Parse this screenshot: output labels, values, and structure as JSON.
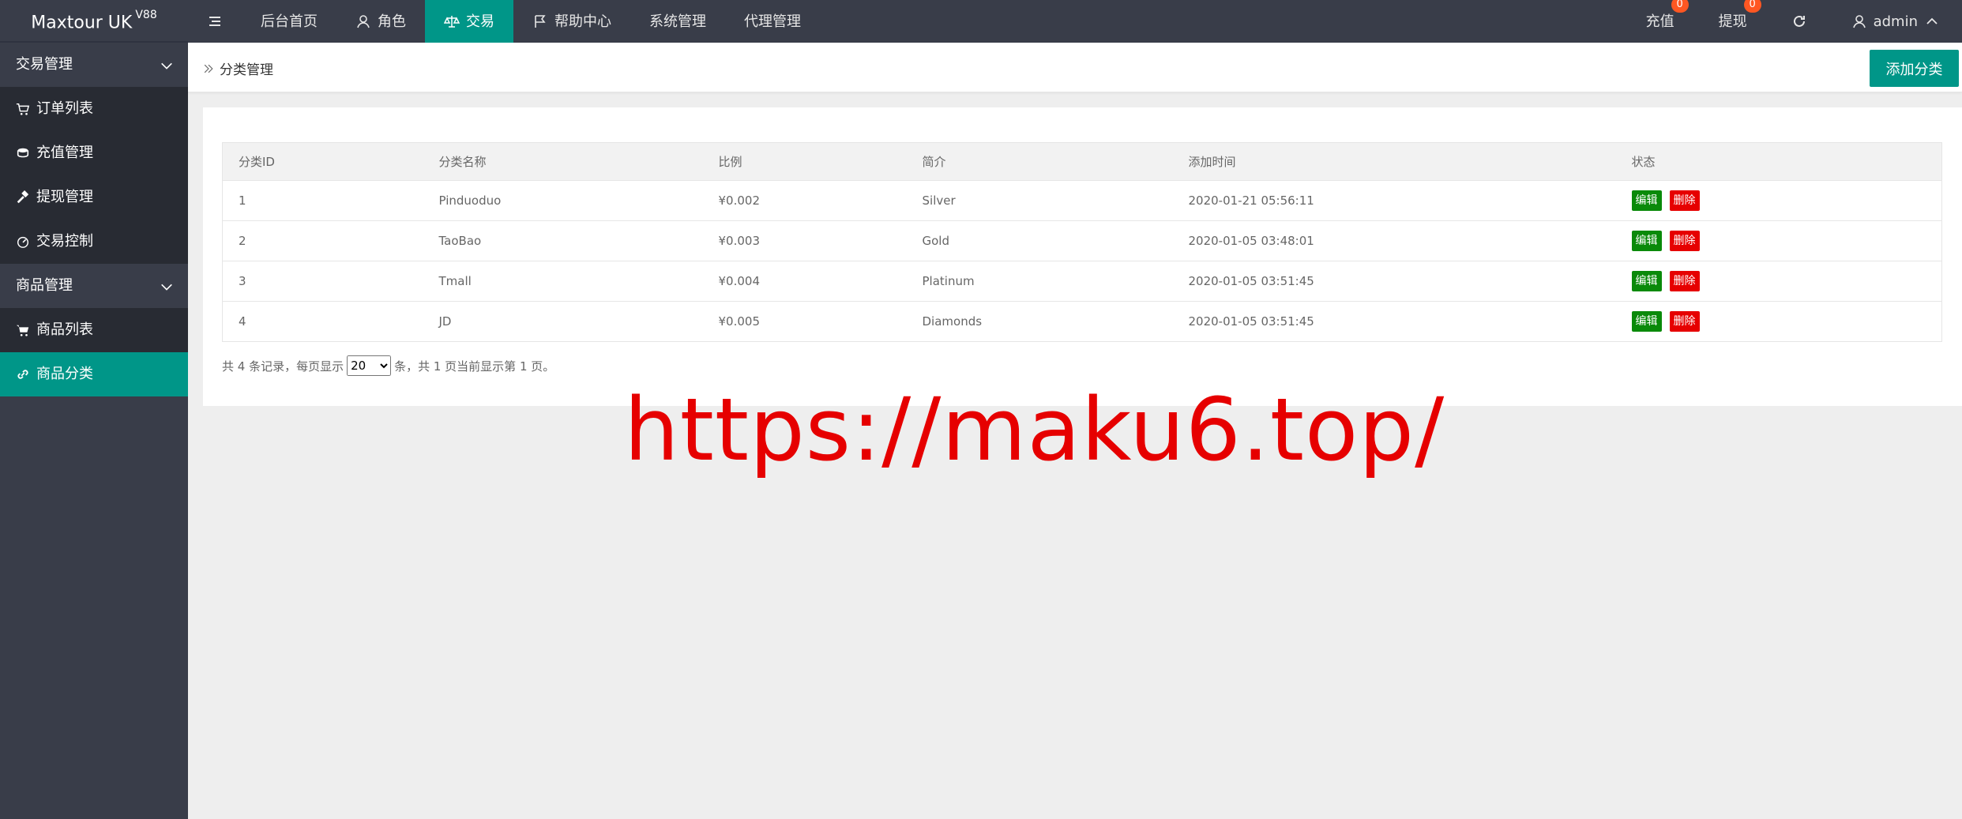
{
  "brand": {
    "name": "Maxtour UK",
    "version": "V88"
  },
  "nav": {
    "items": [
      {
        "label": "后台首页"
      },
      {
        "label": "角色"
      },
      {
        "label": "交易"
      },
      {
        "label": "帮助中心"
      },
      {
        "label": "系统管理"
      },
      {
        "label": "代理管理"
      }
    ],
    "active_index": 2,
    "right": {
      "recharge_label": "充值",
      "recharge_count": "0",
      "withdraw_label": "提现",
      "withdraw_count": "0",
      "user_label": "admin"
    }
  },
  "sidebar": {
    "group1": {
      "label": "交易管理"
    },
    "group1_items": [
      {
        "label": "订单列表"
      },
      {
        "label": "充值管理"
      },
      {
        "label": "提现管理"
      },
      {
        "label": "交易控制"
      }
    ],
    "group2": {
      "label": "商品管理"
    },
    "group2_items": [
      {
        "label": "商品列表"
      },
      {
        "label": "商品分类"
      }
    ]
  },
  "breadcrumb": {
    "label": "分类管理"
  },
  "add_button": {
    "label": "添加分类"
  },
  "table": {
    "headers": [
      "分类ID",
      "分类名称",
      "比例",
      "简介",
      "添加时间",
      "状态"
    ],
    "rows": [
      {
        "id": "1",
        "name": "Pinduoduo",
        "ratio": "¥0.002",
        "intro": "Silver",
        "time": "2020-01-21 05:56:11"
      },
      {
        "id": "2",
        "name": "TaoBao",
        "ratio": "¥0.003",
        "intro": "Gold",
        "time": "2020-01-05 03:48:01"
      },
      {
        "id": "3",
        "name": "Tmall",
        "ratio": "¥0.004",
        "intro": "Platinum",
        "time": "2020-01-05 03:51:45"
      },
      {
        "id": "4",
        "name": "JD",
        "ratio": "¥0.005",
        "intro": "Diamonds",
        "time": "2020-01-05 03:51:45"
      }
    ],
    "edit_label": "编辑",
    "delete_label": "删除"
  },
  "pager": {
    "prefix": "共 4 条记录，每页显示",
    "page_size": "20",
    "suffix": "条，共 1 页当前显示第 1 页。"
  },
  "watermark": "https://maku6.top/",
  "colors": {
    "accent": "#009688",
    "topbar": "#393d49",
    "edit": "#0a8a0a",
    "delete": "#e60000",
    "badge": "#ff5722"
  }
}
